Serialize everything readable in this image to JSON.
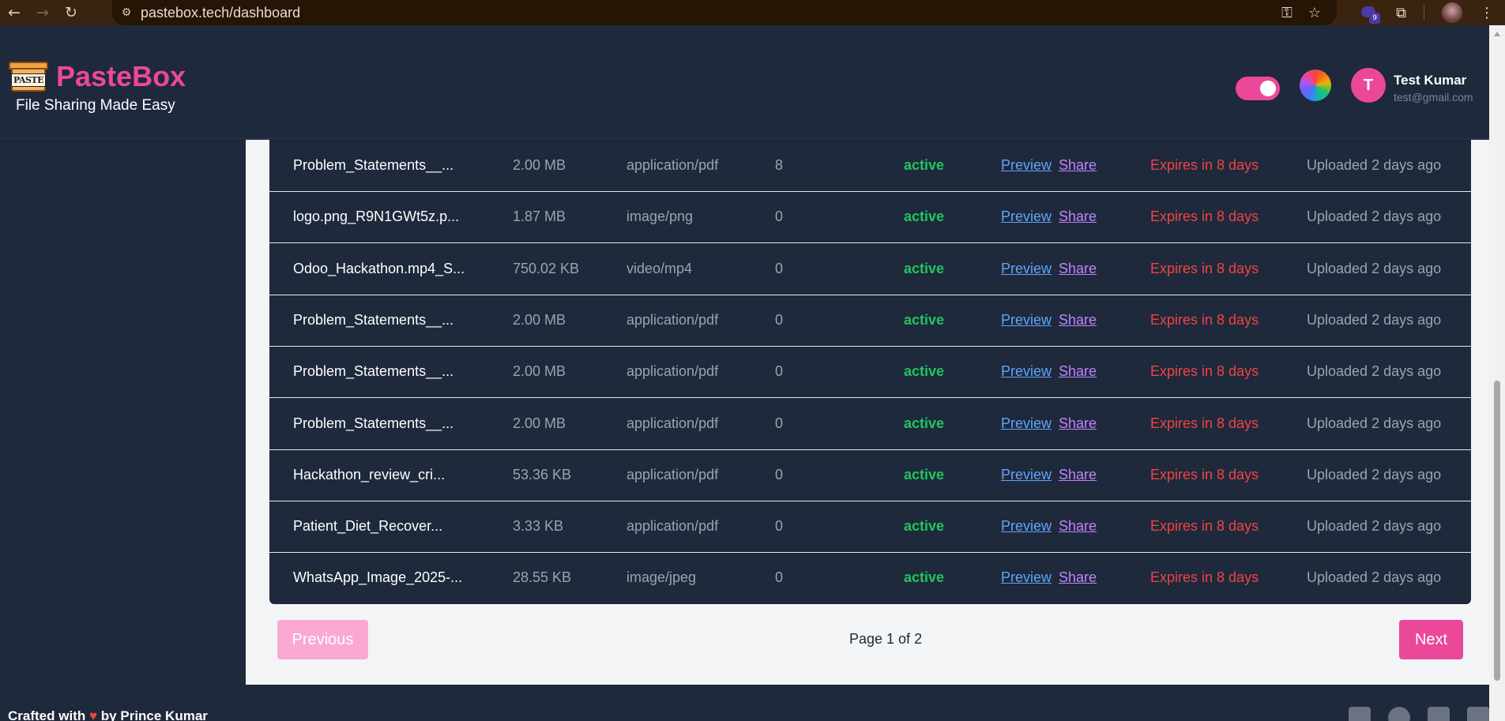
{
  "browser": {
    "url": "pastebox.tech/dashboard",
    "extension_badge": "9"
  },
  "header": {
    "app_name": "PasteBox",
    "logo_text": "PASTE",
    "tagline": "File Sharing Made Easy",
    "user": {
      "initial": "T",
      "name": "Test Kumar",
      "email": "test@gmail.com"
    },
    "theme_toggle_on": true
  },
  "files": [
    {
      "name": "Problem_Statements__...",
      "size": "2.00 MB",
      "type": "application/pdf",
      "downloads": "8",
      "status": "active",
      "preview": "Preview",
      "share": "Share",
      "expiry": "Expires in 8 days",
      "uploaded": "Uploaded 2 days ago"
    },
    {
      "name": "logo.png_R9N1GWt5z.p...",
      "size": "1.87 MB",
      "type": "image/png",
      "downloads": "0",
      "status": "active",
      "preview": "Preview",
      "share": "Share",
      "expiry": "Expires in 8 days",
      "uploaded": "Uploaded 2 days ago"
    },
    {
      "name": "Odoo_Hackathon.mp4_S...",
      "size": "750.02 KB",
      "type": "video/mp4",
      "downloads": "0",
      "status": "active",
      "preview": "Preview",
      "share": "Share",
      "expiry": "Expires in 8 days",
      "uploaded": "Uploaded 2 days ago"
    },
    {
      "name": "Problem_Statements__...",
      "size": "2.00 MB",
      "type": "application/pdf",
      "downloads": "0",
      "status": "active",
      "preview": "Preview",
      "share": "Share",
      "expiry": "Expires in 8 days",
      "uploaded": "Uploaded 2 days ago"
    },
    {
      "name": "Problem_Statements__...",
      "size": "2.00 MB",
      "type": "application/pdf",
      "downloads": "0",
      "status": "active",
      "preview": "Preview",
      "share": "Share",
      "expiry": "Expires in 8 days",
      "uploaded": "Uploaded 2 days ago"
    },
    {
      "name": "Problem_Statements__...",
      "size": "2.00 MB",
      "type": "application/pdf",
      "downloads": "0",
      "status": "active",
      "preview": "Preview",
      "share": "Share",
      "expiry": "Expires in 8 days",
      "uploaded": "Uploaded 2 days ago"
    },
    {
      "name": "Hackathon_review_cri...",
      "size": "53.36 KB",
      "type": "application/pdf",
      "downloads": "0",
      "status": "active",
      "preview": "Preview",
      "share": "Share",
      "expiry": "Expires in 8 days",
      "uploaded": "Uploaded 2 days ago"
    },
    {
      "name": "Patient_Diet_Recover...",
      "size": "3.33 KB",
      "type": "application/pdf",
      "downloads": "0",
      "status": "active",
      "preview": "Preview",
      "share": "Share",
      "expiry": "Expires in 8 days",
      "uploaded": "Uploaded 2 days ago"
    },
    {
      "name": "WhatsApp_Image_2025-...",
      "size": "28.55 KB",
      "type": "image/jpeg",
      "downloads": "0",
      "status": "active",
      "preview": "Preview",
      "share": "Share",
      "expiry": "Expires in 8 days",
      "uploaded": "Uploaded 2 days ago"
    }
  ],
  "pagination": {
    "previous_label": "Previous",
    "page_label": "Page 1 of 2",
    "next_label": "Next"
  },
  "footer": {
    "prefix": "Crafted with",
    "suffix": "by Prince Kumar",
    "social_icons": [
      "linkedin-icon",
      "github-icon",
      "instagram-icon",
      "mail-icon"
    ]
  },
  "colors": {
    "brand": "#ec4899",
    "panel": "#1e293b",
    "status_active": "#22c55e",
    "expiry": "#ef4444",
    "preview_link": "#60a5fa",
    "share_link": "#c084fc"
  }
}
